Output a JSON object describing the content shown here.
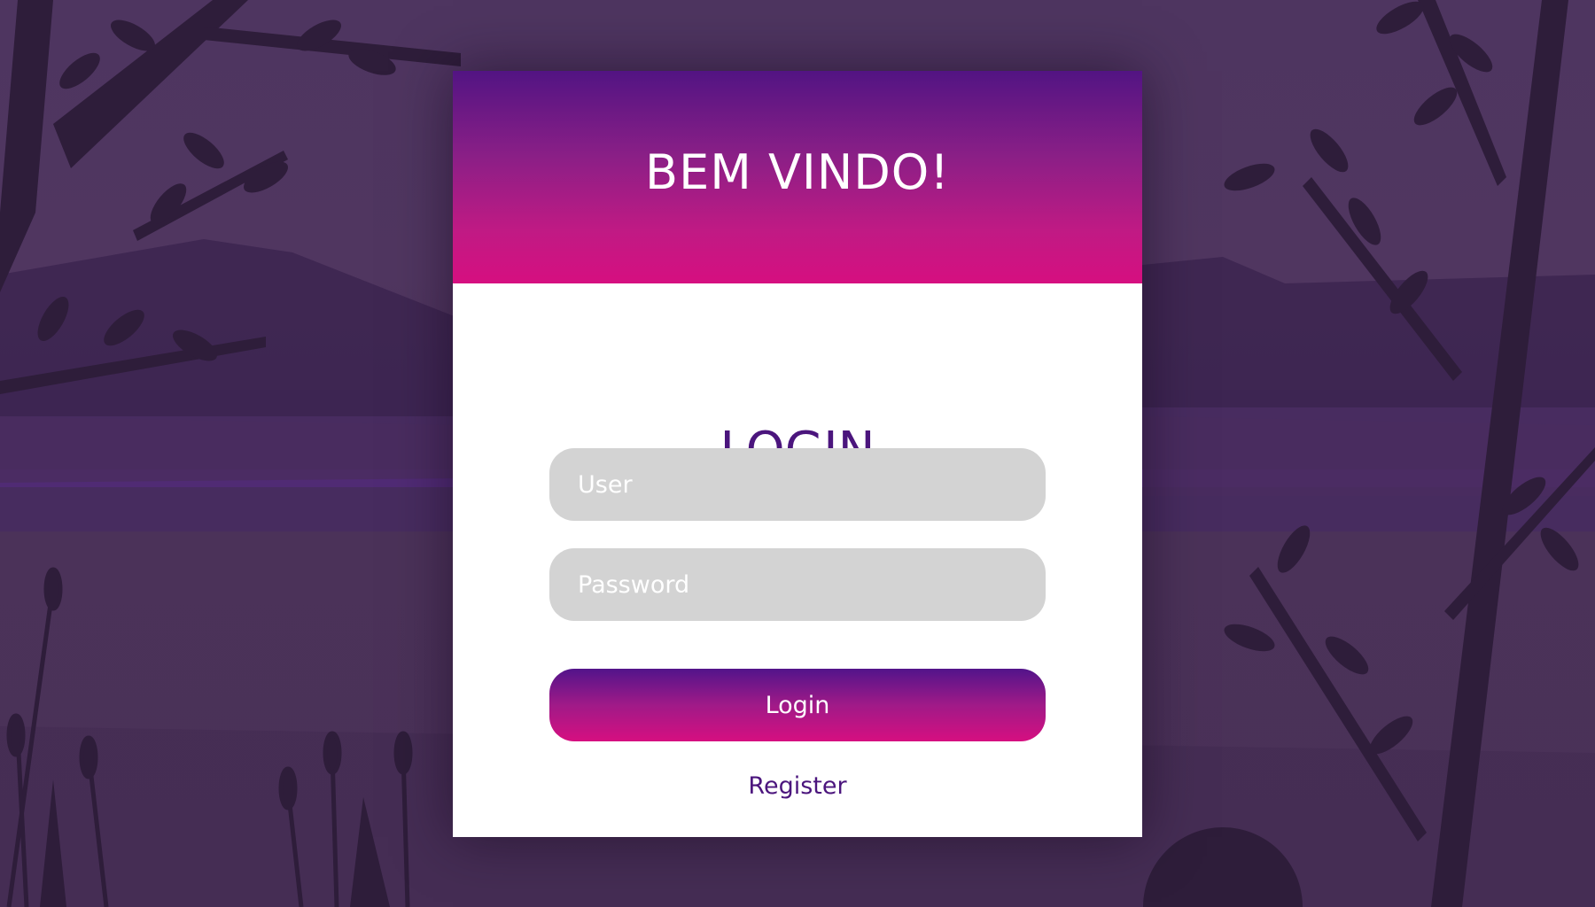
{
  "header": {
    "welcome": "BEM VINDO!"
  },
  "form": {
    "title": "LOGIN",
    "user_placeholder": "User",
    "password_placeholder": "Password",
    "login_label": "Login",
    "register_label": "Register"
  },
  "colors": {
    "primary_purple": "#521483",
    "primary_magenta": "#d60f80",
    "text_purple": "#4b157d",
    "input_gray": "#d3d3d3"
  }
}
